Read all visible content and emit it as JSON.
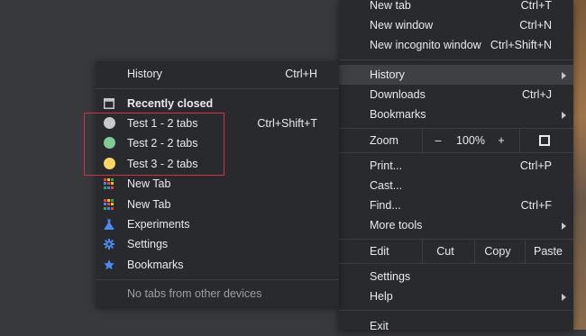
{
  "main_menu": {
    "new_tab": {
      "label": "New tab",
      "shortcut": "Ctrl+T"
    },
    "new_window": {
      "label": "New window",
      "shortcut": "Ctrl+N"
    },
    "new_incognito": {
      "label": "New incognito window",
      "shortcut": "Ctrl+Shift+N"
    },
    "history": {
      "label": "History"
    },
    "downloads": {
      "label": "Downloads",
      "shortcut": "Ctrl+J"
    },
    "bookmarks": {
      "label": "Bookmarks"
    },
    "zoom": {
      "label": "Zoom",
      "minus": "–",
      "level": "100%",
      "plus": "+"
    },
    "print": {
      "label": "Print...",
      "shortcut": "Ctrl+P"
    },
    "cast": {
      "label": "Cast..."
    },
    "find": {
      "label": "Find...",
      "shortcut": "Ctrl+F"
    },
    "more_tools": {
      "label": "More tools"
    },
    "edit": {
      "label": "Edit",
      "cut": "Cut",
      "copy": "Copy",
      "paste": "Paste"
    },
    "settings": {
      "label": "Settings"
    },
    "help": {
      "label": "Help"
    },
    "exit": {
      "label": "Exit"
    }
  },
  "history_menu": {
    "history": {
      "label": "History",
      "shortcut": "Ctrl+H"
    },
    "recently_closed": "Recently closed",
    "closed_items": [
      {
        "label": "Test 1 - 2 tabs",
        "shortcut": "Ctrl+Shift+T",
        "color": "#c8c9cc"
      },
      {
        "label": "Test 2 - 2 tabs",
        "shortcut": "",
        "color": "#81c995"
      },
      {
        "label": "Test 3 - 2 tabs",
        "shortcut": "",
        "color": "#fdd663"
      }
    ],
    "new_tab_1": "New Tab",
    "new_tab_2": "New Tab",
    "experiments": "Experiments",
    "settings": "Settings",
    "bookmarks": "Bookmarks",
    "no_tabs": "No tabs from other devices"
  },
  "colors": {
    "menu_bg": "#292a2d",
    "highlight": "#3f4043",
    "accent_blue": "#4a8af4",
    "red_box": "#d0343a"
  }
}
